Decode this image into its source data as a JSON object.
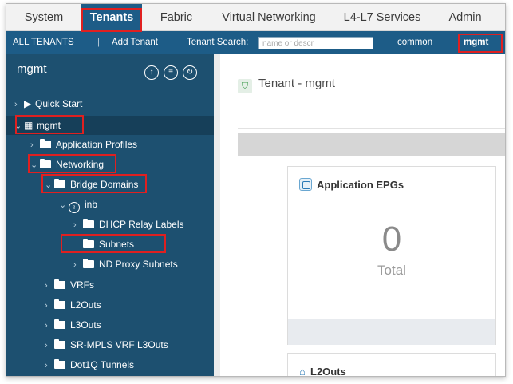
{
  "topnav": {
    "tabs": [
      {
        "label": "System"
      },
      {
        "label": "Tenants"
      },
      {
        "label": "Fabric"
      },
      {
        "label": "Virtual Networking"
      },
      {
        "label": "L4-L7 Services"
      },
      {
        "label": "Admin"
      }
    ],
    "active_tab": "Tenants"
  },
  "subnav": {
    "all_tenants": "ALL TENANTS",
    "sep": "|",
    "add_tenant": "Add Tenant",
    "search_label": "Tenant Search:",
    "search_placeholder": "name or descr",
    "common": "common",
    "mgmt": "mgmt"
  },
  "sidebar": {
    "title": "mgmt",
    "items": [
      {
        "label": "Quick Start",
        "icon": "quick-start-icon"
      },
      {
        "label": "mgmt",
        "icon": "tenant-icon"
      },
      {
        "label": "Application Profiles",
        "icon": "folder-icon"
      },
      {
        "label": "Networking",
        "icon": "folder-icon"
      },
      {
        "label": "Bridge Domains",
        "icon": "folder-icon"
      },
      {
        "label": "inb",
        "icon": "bridge-domain-icon"
      },
      {
        "label": "DHCP Relay Labels",
        "icon": "folder-icon"
      },
      {
        "label": "Subnets",
        "icon": "folder-icon"
      },
      {
        "label": "ND Proxy Subnets",
        "icon": "folder-icon"
      },
      {
        "label": "VRFs",
        "icon": "folder-icon"
      },
      {
        "label": "L2Outs",
        "icon": "folder-icon"
      },
      {
        "label": "L3Outs",
        "icon": "folder-icon"
      },
      {
        "label": "SR-MPLS VRF L3Outs",
        "icon": "folder-icon"
      },
      {
        "label": "Dot1Q Tunnels",
        "icon": "folder-icon"
      }
    ]
  },
  "main": {
    "title": "Tenant - mgmt",
    "card": {
      "title": "Application EPGs",
      "value": "0",
      "label": "Total"
    },
    "card2": {
      "title": "L2Outs"
    }
  },
  "colors": {
    "nav_blue": "#1d5c87",
    "sidebar": "#1d5070",
    "highlight": "#e02020"
  }
}
